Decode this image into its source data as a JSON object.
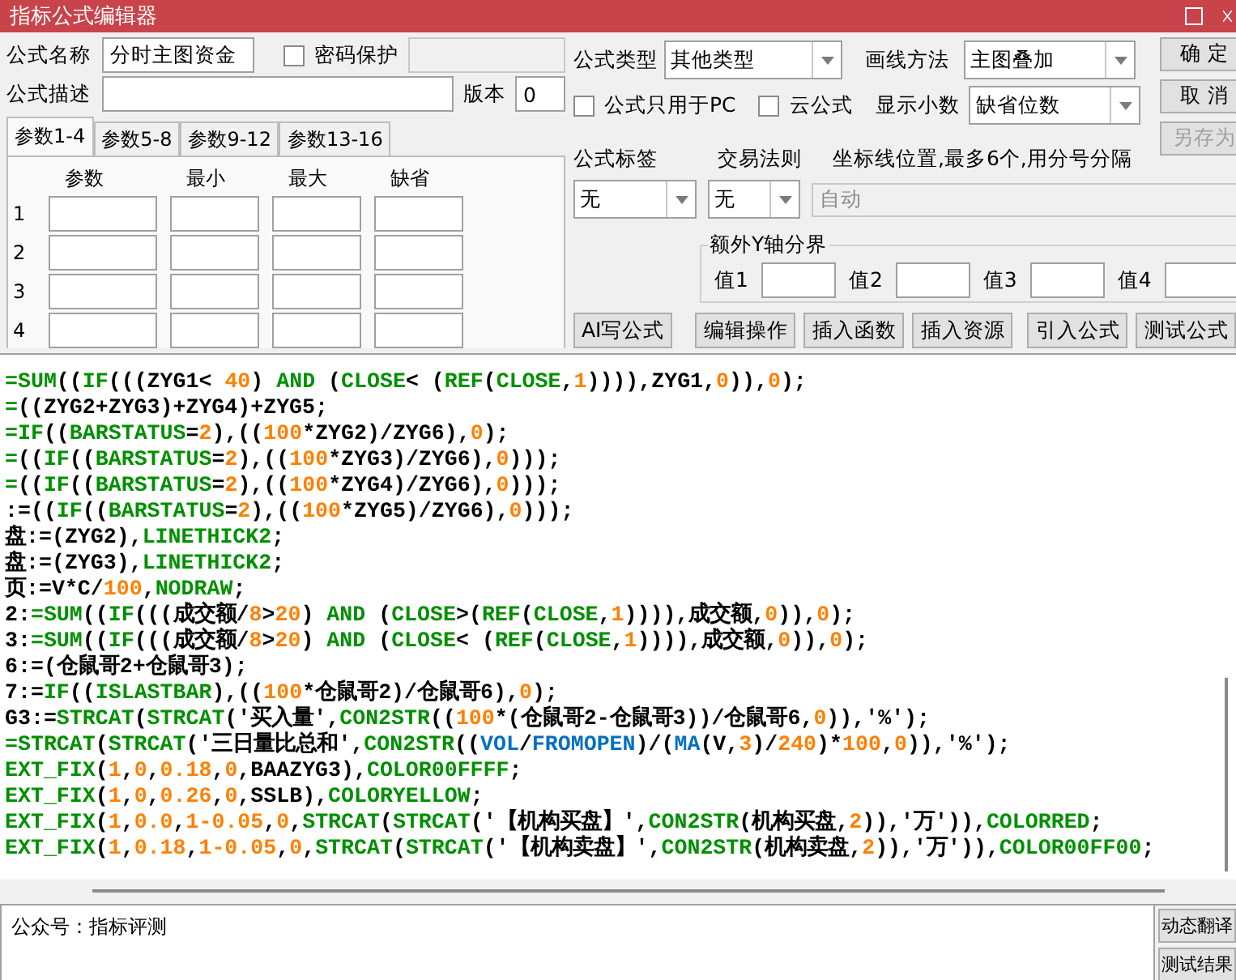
{
  "window": {
    "title": "指标公式编辑器"
  },
  "formula": {
    "name_label": "公式名称",
    "name": "分时主图资金",
    "password": {
      "label": "密码保护",
      "checked": false
    },
    "desc_label": "公式描述",
    "version_label": "版本",
    "version": "0"
  },
  "param_tabs": [
    {
      "label": "参数1-4",
      "selected": true
    },
    {
      "label": "参数5-8",
      "selected": false
    },
    {
      "label": "参数9-12",
      "selected": false
    },
    {
      "label": "参数13-16",
      "selected": false
    }
  ],
  "param_columns": [
    "参数",
    "最小",
    "最大",
    "缺省"
  ],
  "param_rows": [
    "1",
    "2",
    "3",
    "4"
  ],
  "type": {
    "label": "公式类型",
    "value": "其他类型"
  },
  "draw": {
    "label": "画线方法",
    "value": "主图叠加"
  },
  "options": [
    {
      "label": "公式只用于PC",
      "checked": false
    },
    {
      "label": "云公式",
      "checked": false
    }
  ],
  "decimals": {
    "label": "显示小数",
    "value": "缺省位数"
  },
  "tag": {
    "label": "公式标签",
    "value": "无"
  },
  "rule": {
    "label": "交易法则",
    "value": "无"
  },
  "axis": {
    "label": "坐标线位置,最多6个,用分号分隔",
    "value": "自动",
    "disabled": true
  },
  "y_bounds": {
    "title": "额外Y轴分界",
    "items": [
      "值1",
      "值2",
      "值3",
      "值4"
    ]
  },
  "tool_buttons": [
    "AI写公式",
    "编辑操作",
    "插入函数",
    "插入资源",
    "引入公式",
    "测试公式"
  ],
  "side_buttons": [
    {
      "label": "确 定",
      "disabled": false
    },
    {
      "label": "取 消",
      "disabled": false
    },
    {
      "label": "另存为",
      "disabled": true
    }
  ],
  "code": [
    [
      {
        "kind": "keyword",
        "text": "=SUM"
      },
      {
        "kind": "plain",
        "text": "(("
      },
      {
        "kind": "keyword",
        "text": "IF"
      },
      {
        "kind": "plain",
        "text": "(((ZYG1< "
      },
      {
        "kind": "number",
        "text": "40"
      },
      {
        "kind": "plain",
        "text": ") "
      },
      {
        "kind": "keyword",
        "text": "AND"
      },
      {
        "kind": "plain",
        "text": " ("
      },
      {
        "kind": "keyword",
        "text": "CLOSE"
      },
      {
        "kind": "plain",
        "text": "< ("
      },
      {
        "kind": "keyword",
        "text": "REF"
      },
      {
        "kind": "plain",
        "text": "("
      },
      {
        "kind": "keyword",
        "text": "CLOSE"
      },
      {
        "kind": "plain",
        "text": ","
      },
      {
        "kind": "number",
        "text": "1"
      },
      {
        "kind": "plain",
        "text": ")))),ZYG1,"
      },
      {
        "kind": "number",
        "text": "0"
      },
      {
        "kind": "plain",
        "text": ")),"
      },
      {
        "kind": "number",
        "text": "0"
      },
      {
        "kind": "plain",
        "text": ");"
      }
    ],
    [
      {
        "kind": "keyword",
        "text": "="
      },
      {
        "kind": "plain",
        "text": "((ZYG2+ZYG3)+ZYG4)+ZYG5;"
      }
    ],
    [
      {
        "kind": "keyword",
        "text": "=IF"
      },
      {
        "kind": "plain",
        "text": "(("
      },
      {
        "kind": "keyword",
        "text": "BARSTATUS"
      },
      {
        "kind": "plain",
        "text": "="
      },
      {
        "kind": "number",
        "text": "2"
      },
      {
        "kind": "plain",
        "text": "),(("
      },
      {
        "kind": "number",
        "text": "100"
      },
      {
        "kind": "plain",
        "text": "*ZYG2)/ZYG6),"
      },
      {
        "kind": "number",
        "text": "0"
      },
      {
        "kind": "plain",
        "text": ");"
      }
    ],
    [
      {
        "kind": "keyword",
        "text": "="
      },
      {
        "kind": "plain",
        "text": "(("
      },
      {
        "kind": "keyword",
        "text": "IF"
      },
      {
        "kind": "plain",
        "text": "(("
      },
      {
        "kind": "keyword",
        "text": "BARSTATUS"
      },
      {
        "kind": "plain",
        "text": "="
      },
      {
        "kind": "number",
        "text": "2"
      },
      {
        "kind": "plain",
        "text": "),(("
      },
      {
        "kind": "number",
        "text": "100"
      },
      {
        "kind": "plain",
        "text": "*ZYG3)/ZYG6),"
      },
      {
        "kind": "number",
        "text": "0"
      },
      {
        "kind": "plain",
        "text": ")));"
      }
    ],
    [
      {
        "kind": "keyword",
        "text": "="
      },
      {
        "kind": "plain",
        "text": "(("
      },
      {
        "kind": "keyword",
        "text": "IF"
      },
      {
        "kind": "plain",
        "text": "(("
      },
      {
        "kind": "keyword",
        "text": "BARSTATUS"
      },
      {
        "kind": "plain",
        "text": "="
      },
      {
        "kind": "number",
        "text": "2"
      },
      {
        "kind": "plain",
        "text": "),(("
      },
      {
        "kind": "number",
        "text": "100"
      },
      {
        "kind": "plain",
        "text": "*ZYG4)/ZYG6),"
      },
      {
        "kind": "number",
        "text": "0"
      },
      {
        "kind": "plain",
        "text": ")));"
      }
    ],
    [
      {
        "kind": "plain",
        "text": ":=(("
      },
      {
        "kind": "keyword",
        "text": "IF"
      },
      {
        "kind": "plain",
        "text": "(("
      },
      {
        "kind": "keyword",
        "text": "BARSTATUS"
      },
      {
        "kind": "plain",
        "text": "="
      },
      {
        "kind": "number",
        "text": "2"
      },
      {
        "kind": "plain",
        "text": "),(("
      },
      {
        "kind": "number",
        "text": "100"
      },
      {
        "kind": "plain",
        "text": "*ZYG5)/ZYG6),"
      },
      {
        "kind": "number",
        "text": "0"
      },
      {
        "kind": "plain",
        "text": ")));"
      }
    ],
    [
      {
        "kind": "plain",
        "text": "盘:=(ZYG2),"
      },
      {
        "kind": "keyword",
        "text": "LINETHICK2"
      },
      {
        "kind": "plain",
        "text": ";"
      }
    ],
    [
      {
        "kind": "plain",
        "text": "盘:=(ZYG3),"
      },
      {
        "kind": "keyword",
        "text": "LINETHICK2"
      },
      {
        "kind": "plain",
        "text": ";"
      }
    ],
    [
      {
        "kind": "plain",
        "text": "页:=V*C/"
      },
      {
        "kind": "number",
        "text": "100"
      },
      {
        "kind": "plain",
        "text": ","
      },
      {
        "kind": "keyword",
        "text": "NODRAW"
      },
      {
        "kind": "plain",
        "text": ";"
      }
    ],
    [
      {
        "kind": "plain",
        "text": "2:"
      },
      {
        "kind": "keyword",
        "text": "=SUM"
      },
      {
        "kind": "plain",
        "text": "(("
      },
      {
        "kind": "keyword",
        "text": "IF"
      },
      {
        "kind": "plain",
        "text": "(((成交额/"
      },
      {
        "kind": "number",
        "text": "8"
      },
      {
        "kind": "plain",
        "text": ">"
      },
      {
        "kind": "number",
        "text": "20"
      },
      {
        "kind": "plain",
        "text": ") "
      },
      {
        "kind": "keyword",
        "text": "AND"
      },
      {
        "kind": "plain",
        "text": " ("
      },
      {
        "kind": "keyword",
        "text": "CLOSE"
      },
      {
        "kind": "plain",
        "text": ">("
      },
      {
        "kind": "keyword",
        "text": "REF"
      },
      {
        "kind": "plain",
        "text": "("
      },
      {
        "kind": "keyword",
        "text": "CLOSE"
      },
      {
        "kind": "plain",
        "text": ","
      },
      {
        "kind": "number",
        "text": "1"
      },
      {
        "kind": "plain",
        "text": ")))),成交额,"
      },
      {
        "kind": "number",
        "text": "0"
      },
      {
        "kind": "plain",
        "text": ")),"
      },
      {
        "kind": "number",
        "text": "0"
      },
      {
        "kind": "plain",
        "text": ");"
      }
    ],
    [
      {
        "kind": "plain",
        "text": "3:"
      },
      {
        "kind": "keyword",
        "text": "=SUM"
      },
      {
        "kind": "plain",
        "text": "(("
      },
      {
        "kind": "keyword",
        "text": "IF"
      },
      {
        "kind": "plain",
        "text": "(((成交额/"
      },
      {
        "kind": "number",
        "text": "8"
      },
      {
        "kind": "plain",
        "text": ">"
      },
      {
        "kind": "number",
        "text": "20"
      },
      {
        "kind": "plain",
        "text": ") "
      },
      {
        "kind": "keyword",
        "text": "AND"
      },
      {
        "kind": "plain",
        "text": " ("
      },
      {
        "kind": "keyword",
        "text": "CLOSE"
      },
      {
        "kind": "plain",
        "text": "< ("
      },
      {
        "kind": "keyword",
        "text": "REF"
      },
      {
        "kind": "plain",
        "text": "("
      },
      {
        "kind": "keyword",
        "text": "CLOSE"
      },
      {
        "kind": "plain",
        "text": ","
      },
      {
        "kind": "number",
        "text": "1"
      },
      {
        "kind": "plain",
        "text": ")))),成交额,"
      },
      {
        "kind": "number",
        "text": "0"
      },
      {
        "kind": "plain",
        "text": ")),"
      },
      {
        "kind": "number",
        "text": "0"
      },
      {
        "kind": "plain",
        "text": ");"
      }
    ],
    [
      {
        "kind": "plain",
        "text": "6:=(仓鼠哥2+仓鼠哥3);"
      }
    ],
    [
      {
        "kind": "plain",
        "text": "7:="
      },
      {
        "kind": "keyword",
        "text": "IF"
      },
      {
        "kind": "plain",
        "text": "(("
      },
      {
        "kind": "keyword",
        "text": "ISLASTBAR"
      },
      {
        "kind": "plain",
        "text": "),(("
      },
      {
        "kind": "number",
        "text": "100"
      },
      {
        "kind": "plain",
        "text": "*仓鼠哥2)/仓鼠哥6),"
      },
      {
        "kind": "number",
        "text": "0"
      },
      {
        "kind": "plain",
        "text": ");"
      }
    ],
    [
      {
        "kind": "plain",
        "text": "G3:="
      },
      {
        "kind": "keyword",
        "text": "STRCAT"
      },
      {
        "kind": "plain",
        "text": "("
      },
      {
        "kind": "keyword",
        "text": "STRCAT"
      },
      {
        "kind": "plain",
        "text": "('买入量',"
      },
      {
        "kind": "keyword",
        "text": "CON2STR"
      },
      {
        "kind": "plain",
        "text": "(("
      },
      {
        "kind": "number",
        "text": "100"
      },
      {
        "kind": "plain",
        "text": "*(仓鼠哥2-仓鼠哥3))/仓鼠哥6,"
      },
      {
        "kind": "number",
        "text": "0"
      },
      {
        "kind": "plain",
        "text": ")),'%');"
      }
    ],
    [
      {
        "kind": "keyword",
        "text": "=STRCAT"
      },
      {
        "kind": "plain",
        "text": "("
      },
      {
        "kind": "keyword",
        "text": "STRCAT"
      },
      {
        "kind": "plain",
        "text": "('三日量比总和',"
      },
      {
        "kind": "keyword",
        "text": "CON2STR"
      },
      {
        "kind": "plain",
        "text": "(("
      },
      {
        "kind": "builtin",
        "text": "VOL"
      },
      {
        "kind": "plain",
        "text": "/"
      },
      {
        "kind": "builtin",
        "text": "FROMOPEN"
      },
      {
        "kind": "plain",
        "text": ")/("
      },
      {
        "kind": "builtin",
        "text": "MA"
      },
      {
        "kind": "plain",
        "text": "(V,"
      },
      {
        "kind": "number",
        "text": "3"
      },
      {
        "kind": "plain",
        "text": ")/"
      },
      {
        "kind": "number",
        "text": "240"
      },
      {
        "kind": "plain",
        "text": ")*"
      },
      {
        "kind": "number",
        "text": "100"
      },
      {
        "kind": "plain",
        "text": ","
      },
      {
        "kind": "number",
        "text": "0"
      },
      {
        "kind": "plain",
        "text": ")),'%');"
      }
    ],
    [
      {
        "kind": "keyword",
        "text": "EXT_FIX"
      },
      {
        "kind": "plain",
        "text": "("
      },
      {
        "kind": "number",
        "text": "1"
      },
      {
        "kind": "plain",
        "text": ","
      },
      {
        "kind": "number",
        "text": "0"
      },
      {
        "kind": "plain",
        "text": ","
      },
      {
        "kind": "number",
        "text": "0.18"
      },
      {
        "kind": "plain",
        "text": ","
      },
      {
        "kind": "number",
        "text": "0"
      },
      {
        "kind": "plain",
        "text": ",BAAZYG3),"
      },
      {
        "kind": "keyword",
        "text": "COLOR00FFFF"
      },
      {
        "kind": "plain",
        "text": ";"
      }
    ],
    [
      {
        "kind": "keyword",
        "text": "EXT_FIX"
      },
      {
        "kind": "plain",
        "text": "("
      },
      {
        "kind": "number",
        "text": "1"
      },
      {
        "kind": "plain",
        "text": ","
      },
      {
        "kind": "number",
        "text": "0"
      },
      {
        "kind": "plain",
        "text": ","
      },
      {
        "kind": "number",
        "text": "0.26"
      },
      {
        "kind": "plain",
        "text": ","
      },
      {
        "kind": "number",
        "text": "0"
      },
      {
        "kind": "plain",
        "text": ",SSLB),"
      },
      {
        "kind": "keyword",
        "text": "COLORYELLOW"
      },
      {
        "kind": "plain",
        "text": ";"
      }
    ],
    [
      {
        "kind": "keyword",
        "text": "EXT_FIX"
      },
      {
        "kind": "plain",
        "text": "("
      },
      {
        "kind": "number",
        "text": "1"
      },
      {
        "kind": "plain",
        "text": ","
      },
      {
        "kind": "number",
        "text": "0.0"
      },
      {
        "kind": "plain",
        "text": ","
      },
      {
        "kind": "number",
        "text": "1-0.05"
      },
      {
        "kind": "plain",
        "text": ","
      },
      {
        "kind": "number",
        "text": "0"
      },
      {
        "kind": "plain",
        "text": ","
      },
      {
        "kind": "keyword",
        "text": "STRCAT"
      },
      {
        "kind": "plain",
        "text": "("
      },
      {
        "kind": "keyword",
        "text": "STRCAT"
      },
      {
        "kind": "plain",
        "text": "('【机构买盘】',"
      },
      {
        "kind": "keyword",
        "text": "CON2STR"
      },
      {
        "kind": "plain",
        "text": "(机构买盘,"
      },
      {
        "kind": "number",
        "text": "2"
      },
      {
        "kind": "plain",
        "text": ")),'万')),"
      },
      {
        "kind": "keyword",
        "text": "COLORRED"
      },
      {
        "kind": "plain",
        "text": ";"
      }
    ],
    [
      {
        "kind": "keyword",
        "text": "EXT_FIX"
      },
      {
        "kind": "plain",
        "text": "("
      },
      {
        "kind": "number",
        "text": "1"
      },
      {
        "kind": "plain",
        "text": ","
      },
      {
        "kind": "number",
        "text": "0.18"
      },
      {
        "kind": "plain",
        "text": ","
      },
      {
        "kind": "number",
        "text": "1-0.05"
      },
      {
        "kind": "plain",
        "text": ","
      },
      {
        "kind": "number",
        "text": "0"
      },
      {
        "kind": "plain",
        "text": ","
      },
      {
        "kind": "keyword",
        "text": "STRCAT"
      },
      {
        "kind": "plain",
        "text": "("
      },
      {
        "kind": "keyword",
        "text": "STRCAT"
      },
      {
        "kind": "plain",
        "text": "('【机构卖盘】',"
      },
      {
        "kind": "keyword",
        "text": "CON2STR"
      },
      {
        "kind": "plain",
        "text": "(机构卖盘,"
      },
      {
        "kind": "number",
        "text": "2"
      },
      {
        "kind": "plain",
        "text": ")),'万')),"
      },
      {
        "kind": "keyword",
        "text": "COLOR00FF00"
      },
      {
        "kind": "plain",
        "text": ";"
      }
    ]
  ],
  "output": {
    "text": "公众号：指标评测"
  },
  "output_buttons": [
    "动态翻译",
    "测试结果"
  ]
}
